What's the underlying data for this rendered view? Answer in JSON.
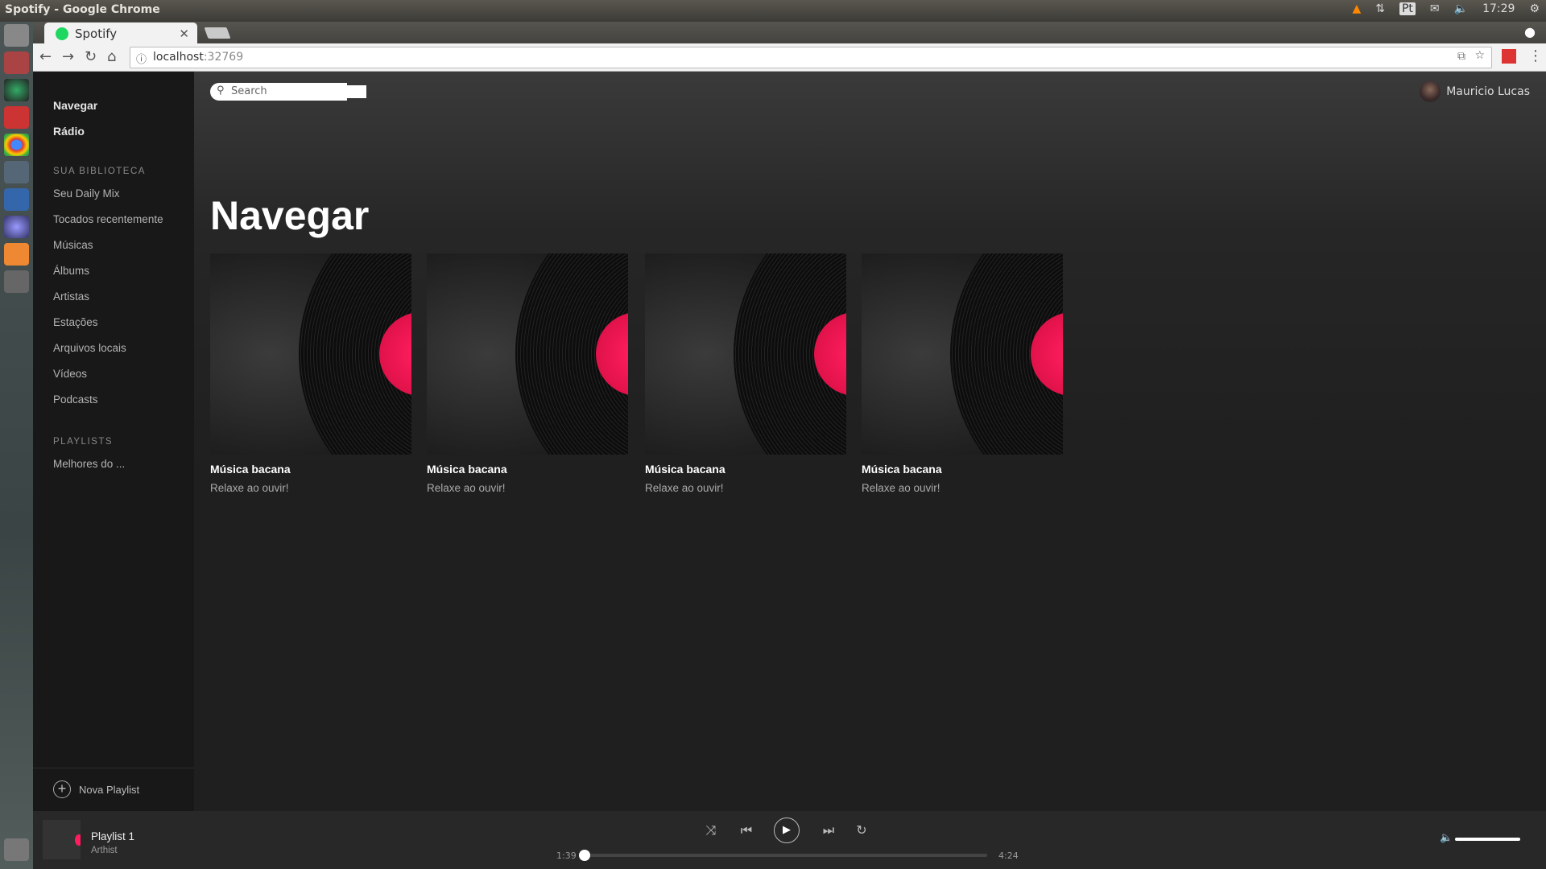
{
  "os": {
    "window_title": "Spotify - Google Chrome",
    "tray": {
      "lang": "Pt",
      "clock": "17:29"
    }
  },
  "browser": {
    "tab_title": "Spotify",
    "url_host": "localhost",
    "url_port": ":32769"
  },
  "header": {
    "search_placeholder": "Search",
    "user_name": "Mauricio Lucas"
  },
  "sidebar": {
    "main": [
      {
        "label": "Navegar"
      },
      {
        "label": "Rádio"
      }
    ],
    "library_heading": "SUA BIBLIOTECA",
    "library": [
      {
        "label": "Seu Daily Mix"
      },
      {
        "label": "Tocados recentemente"
      },
      {
        "label": "Músicas"
      },
      {
        "label": "Álbums"
      },
      {
        "label": "Artistas"
      },
      {
        "label": "Estações"
      },
      {
        "label": "Arquivos locais"
      },
      {
        "label": "Vídeos"
      },
      {
        "label": "Podcasts"
      }
    ],
    "playlists_heading": "PLAYLISTS",
    "playlists": [
      {
        "label": "Melhores do ..."
      }
    ],
    "new_playlist": "Nova Playlist"
  },
  "main": {
    "title": "Navegar",
    "cards": [
      {
        "title": "Música bacana",
        "subtitle": "Relaxe ao ouvir!"
      },
      {
        "title": "Música bacana",
        "subtitle": "Relaxe ao ouvir!"
      },
      {
        "title": "Música bacana",
        "subtitle": "Relaxe ao ouvir!"
      },
      {
        "title": "Música bacana",
        "subtitle": "Relaxe ao ouvir!"
      }
    ]
  },
  "player": {
    "track": "Playlist 1",
    "artist": "Arthist",
    "elapsed": "1:39",
    "duration": "4:24",
    "progress_fraction": 0.0,
    "volume_fraction": 1.0
  },
  "colors": {
    "accent": "#ff1d5e",
    "sidebar_bg": "#181818",
    "player_bg": "#282828"
  }
}
